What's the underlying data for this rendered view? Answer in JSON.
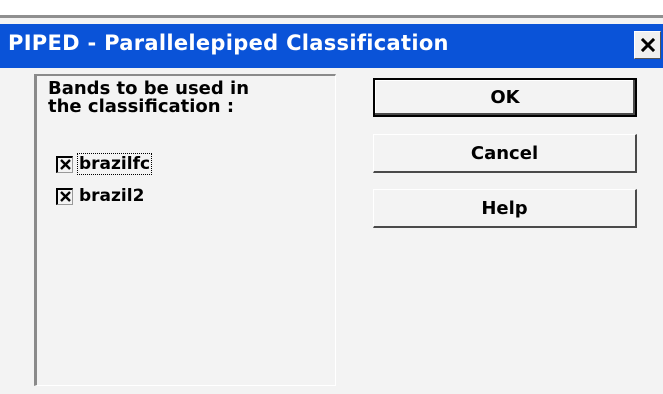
{
  "window": {
    "title": "PIPED - Parallelepiped Classification",
    "close_icon": "close-icon"
  },
  "bands": {
    "label": "Bands to be used in\nthe classification :",
    "items": [
      {
        "label": "brazilfc",
        "checked": true
      },
      {
        "label": "brazil2",
        "checked": true
      }
    ]
  },
  "buttons": {
    "ok_label": "OK",
    "cancel_label": "Cancel",
    "help_label": "Help"
  },
  "colors": {
    "titlebar": "#0a53d8",
    "dialog_bg": "#f3f3f3"
  }
}
